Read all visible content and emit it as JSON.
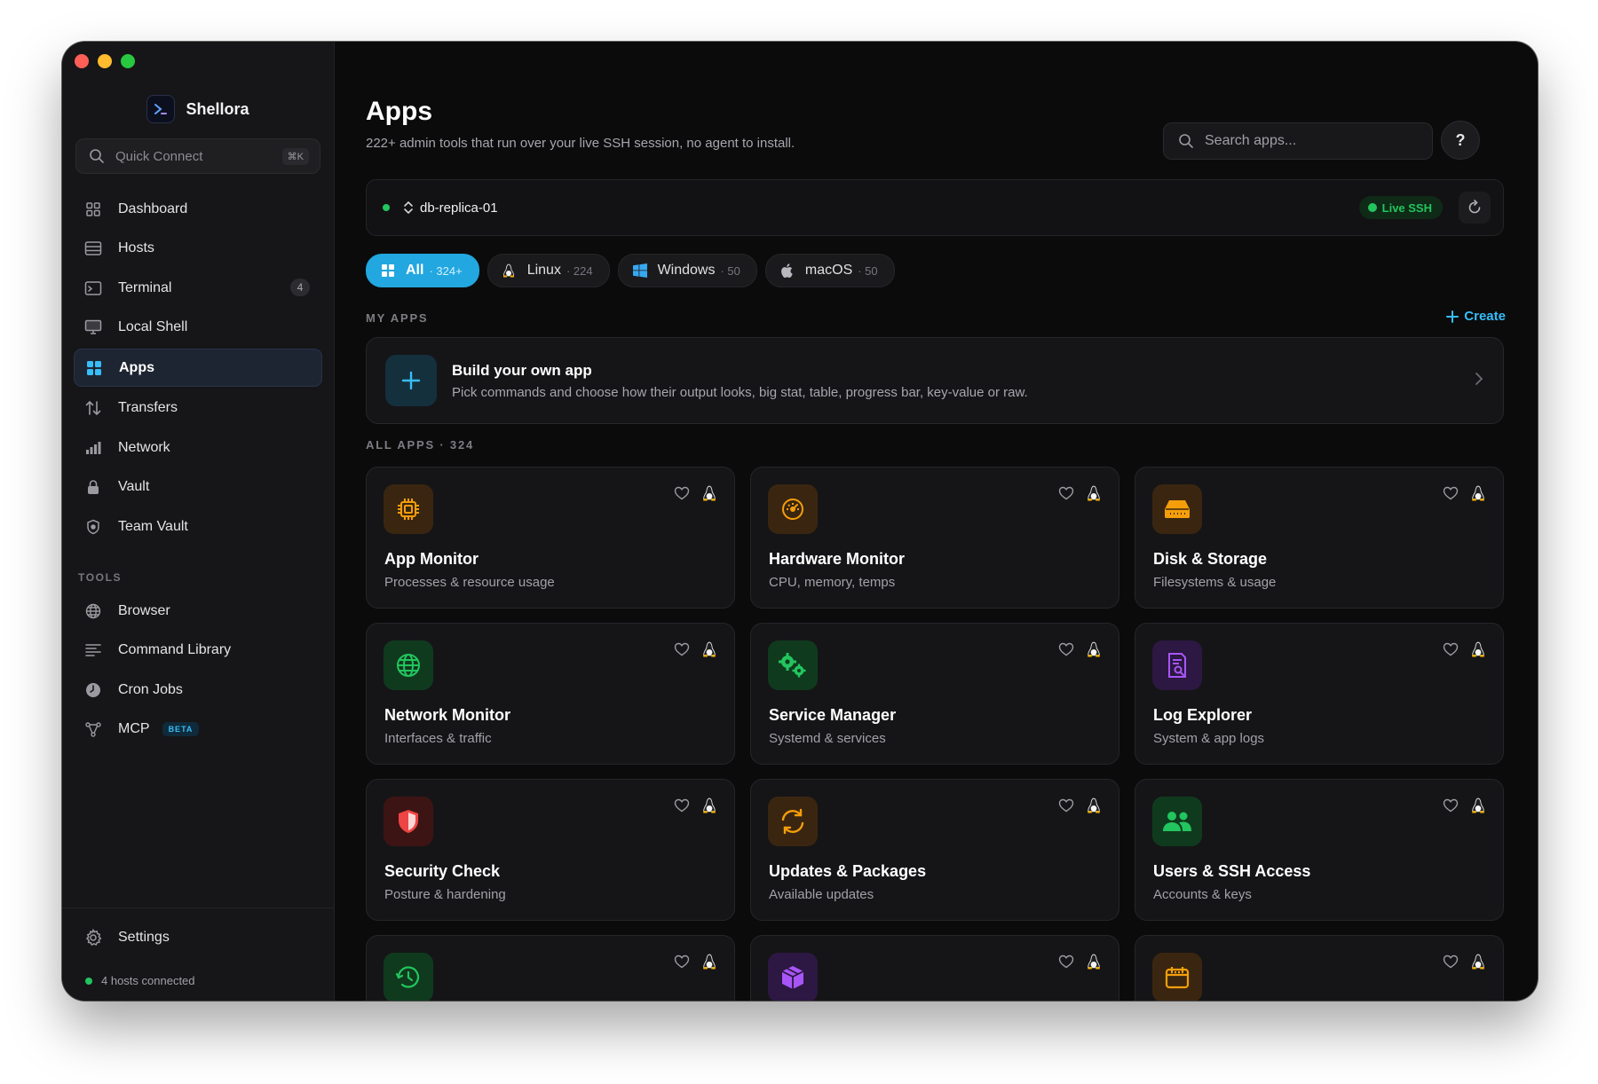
{
  "app": {
    "name": "Shellora"
  },
  "quick_connect": {
    "label": "Quick Connect",
    "shortcut": "⌘K"
  },
  "sidebar": {
    "items": [
      {
        "label": "Dashboard",
        "icon": "grid-icon"
      },
      {
        "label": "Hosts",
        "icon": "server-icon"
      },
      {
        "label": "Terminal",
        "icon": "terminal-icon",
        "badge": "4"
      },
      {
        "label": "Local Shell",
        "icon": "monitor-icon"
      },
      {
        "label": "Apps",
        "icon": "apps-icon",
        "active": true
      },
      {
        "label": "Transfers",
        "icon": "transfer-icon"
      },
      {
        "label": "Network",
        "icon": "bars-icon"
      },
      {
        "label": "Vault",
        "icon": "lock-icon"
      },
      {
        "label": "Team Vault",
        "icon": "shield-icon"
      }
    ],
    "tools_label": "TOOLS",
    "tools": [
      {
        "label": "Browser",
        "icon": "globe-icon"
      },
      {
        "label": "Command Library",
        "icon": "list-icon"
      },
      {
        "label": "Cron Jobs",
        "icon": "clock-icon"
      },
      {
        "label": "MCP",
        "icon": "nodes-icon",
        "badge": "BETA"
      }
    ],
    "settings_label": "Settings",
    "status": "4 hosts connected"
  },
  "header": {
    "title": "Apps",
    "subtitle": "222+ admin tools that run over your live SSH session, no agent to install.",
    "search_placeholder": "Search apps...",
    "help": "?"
  },
  "host": {
    "name": "db-replica-01",
    "status": "Live SSH",
    "accent": "#22c55e"
  },
  "filters": [
    {
      "label": "All",
      "count": "· 324+",
      "active": true
    },
    {
      "label": "Linux",
      "count": "· 224"
    },
    {
      "label": "Windows",
      "count": "· 50"
    },
    {
      "label": "macOS",
      "count": "· 50"
    }
  ],
  "my_apps": {
    "label": "MY APPS",
    "create": "Create",
    "build_title": "Build your own app",
    "build_desc": "Pick commands and choose how their output looks, big stat, table, progress bar, key-value or raw."
  },
  "all_apps": {
    "label": "ALL APPS · 324",
    "cards": [
      {
        "title": "App Monitor",
        "desc": "Processes & resource usage",
        "icon": "chip-icon",
        "color": "#f59e0b"
      },
      {
        "title": "Hardware Monitor",
        "desc": "CPU, memory, temps",
        "icon": "gauge-icon",
        "color": "#f59e0b"
      },
      {
        "title": "Disk & Storage",
        "desc": "Filesystems & usage",
        "icon": "disk-icon",
        "color": "#f59e0b"
      },
      {
        "title": "Network Monitor",
        "desc": "Interfaces & traffic",
        "icon": "globe-icon",
        "color": "#22c55e"
      },
      {
        "title": "Service Manager",
        "desc": "Systemd & services",
        "icon": "gears-icon",
        "color": "#22c55e"
      },
      {
        "title": "Log Explorer",
        "desc": "System & app logs",
        "icon": "doc-search-icon",
        "color": "#a855f7"
      },
      {
        "title": "Security Check",
        "desc": "Posture & hardening",
        "icon": "shield-icon",
        "color": "#ef4444"
      },
      {
        "title": "Updates & Packages",
        "desc": "Available updates",
        "icon": "refresh-icon",
        "color": "#f59e0b"
      },
      {
        "title": "Users & SSH Access",
        "desc": "Accounts & keys",
        "icon": "users-icon",
        "color": "#22c55e"
      },
      {
        "title": "",
        "desc": "",
        "icon": "timer-icon",
        "color": "#22c55e"
      },
      {
        "title": "",
        "desc": "",
        "icon": "package-icon",
        "color": "#a855f7"
      },
      {
        "title": "",
        "desc": "",
        "icon": "calendar-icon",
        "color": "#f59e0b"
      }
    ]
  }
}
